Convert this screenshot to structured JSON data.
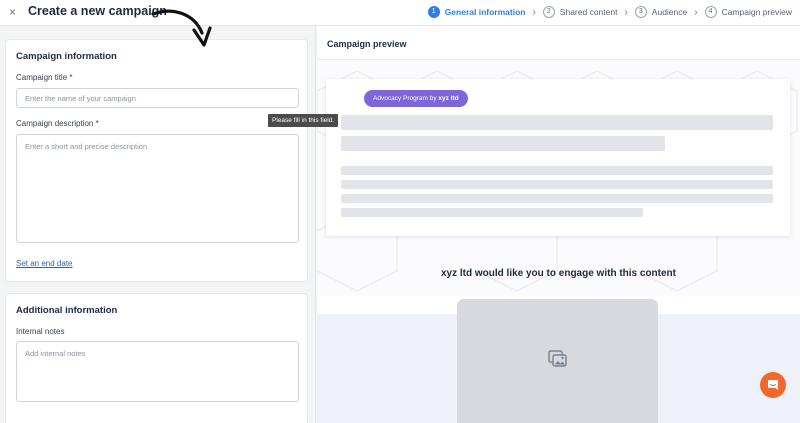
{
  "header": {
    "close_label": "×",
    "title": "Create a new campaign",
    "steps": [
      {
        "num": "1",
        "label": "General information"
      },
      {
        "num": "2",
        "label": "Shared content"
      },
      {
        "num": "3",
        "label": "Audience"
      },
      {
        "num": "4",
        "label": "Campaign preview"
      }
    ],
    "active_step": 1
  },
  "campaign_info": {
    "title": "Campaign information",
    "title_label": "Campaign title *",
    "title_placeholder": "Enter the name of your campaign",
    "description_label": "Campaign description *",
    "description_placeholder": "Enter a short and precise description",
    "end_date_link": "Set an end date",
    "tooltip": "Please fill in this field."
  },
  "additional_info": {
    "title": "Additional information",
    "notes_label": "Internal notes",
    "notes_placeholder": "Add internal notes"
  },
  "preview": {
    "title": "Campaign preview",
    "pill_prefix": "Advocacy Program by",
    "pill_company": "xyz ltd",
    "engage_text": "xyz ltd would like you to engage with this content"
  },
  "colors": {
    "accent": "#2f7ee8",
    "pill": "#7c66d9",
    "chat": "#f2672c"
  }
}
